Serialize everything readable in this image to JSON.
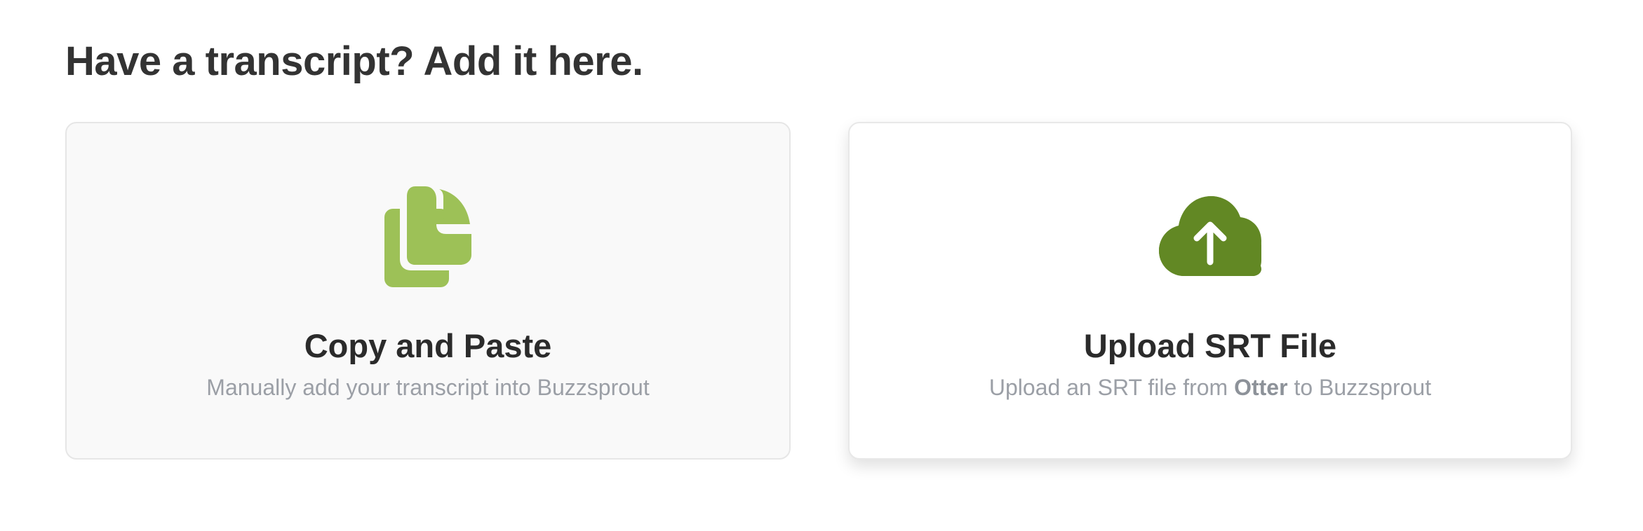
{
  "heading": "Have a transcript? Add it here.",
  "colors": {
    "copy_icon": "#9dc157",
    "upload_icon": "#628824",
    "heading_text": "#333333",
    "muted_text": "#9b9fa6"
  },
  "cards": {
    "copy_paste": {
      "icon": "copy-documents-icon",
      "title": "Copy and Paste",
      "description": "Manually add your transcript into Buzzsprout"
    },
    "upload_srt": {
      "icon": "cloud-upload-icon",
      "title": "Upload SRT File",
      "description_prefix": "Upload an SRT file from ",
      "description_bold": "Otter",
      "description_suffix": " to Buzzsprout"
    }
  }
}
